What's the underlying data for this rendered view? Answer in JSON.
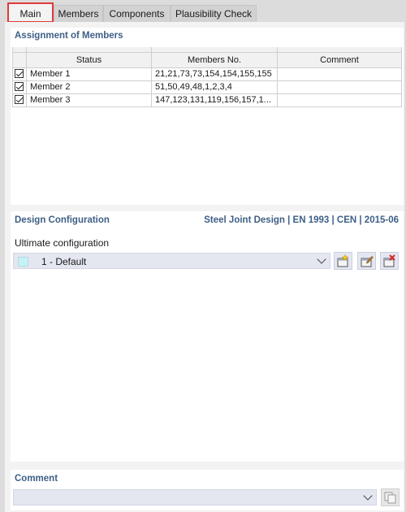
{
  "tabs": [
    {
      "label": "Main",
      "active": true
    },
    {
      "label": "Members",
      "active": false
    },
    {
      "label": "Components",
      "active": false
    },
    {
      "label": "Plausibility Check",
      "active": false
    }
  ],
  "assignment": {
    "title": "Assignment of Members",
    "columns": [
      "Status",
      "Members No.",
      "Comment"
    ],
    "rows": [
      {
        "checked": true,
        "status": "Member 1",
        "members": "21,21,73,73,154,154,155,155",
        "comment": ""
      },
      {
        "checked": true,
        "status": "Member 2",
        "members": "51,50,49,48,1,2,3,4",
        "comment": ""
      },
      {
        "checked": true,
        "status": "Member 3",
        "members": "147,123,131,119,156,157,1...",
        "comment": ""
      }
    ]
  },
  "design": {
    "title": "Design Configuration",
    "standard": "Steel Joint Design | EN 1993 | CEN | 2015-06",
    "ultimate_label": "Ultimate configuration",
    "ultimate_value": "1 - Default",
    "swatch_color": "#c6f2f6"
  },
  "comment": {
    "title": "Comment",
    "value": ""
  },
  "colors": {
    "accent_title": "#3e5f86",
    "active_tab_border": "#e03a3a"
  }
}
